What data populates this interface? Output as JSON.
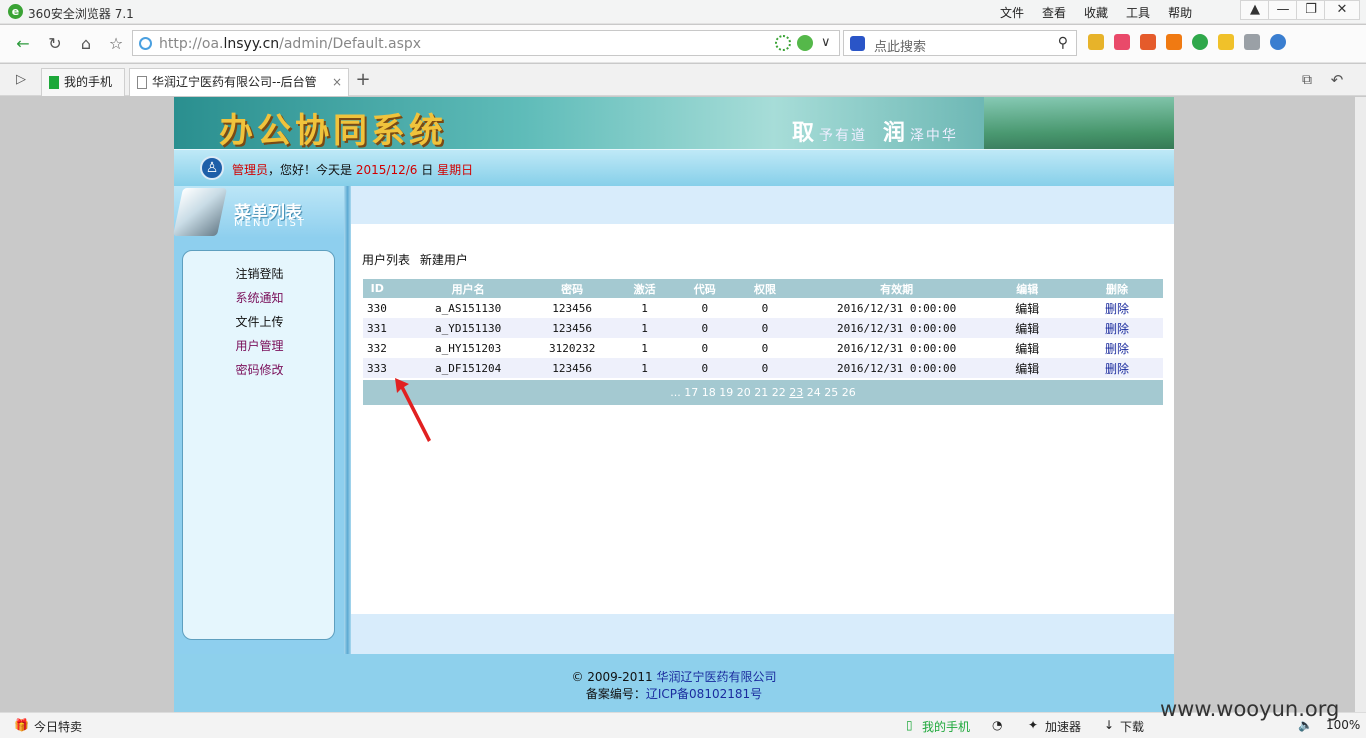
{
  "browser": {
    "title": "360安全浏览器 7.1",
    "menus": [
      "文件",
      "查看",
      "收藏",
      "工具",
      "帮助"
    ],
    "url_prefix": "http://oa.",
    "url_domain": "lnsyy.cn",
    "url_suffix": "/admin/Default.aspx",
    "search_placeholder": "点此搜索",
    "tabs": [
      {
        "label": "我的手机",
        "active": false
      },
      {
        "label": "华润辽宁医药有限公司--后台管",
        "active": true
      }
    ]
  },
  "header": {
    "system_name": "办公协同系统",
    "slogan_char1": "取",
    "slogan_part1": "予有道",
    "slogan_char2": "润",
    "slogan_part2": "泽中华"
  },
  "greeting": {
    "user": "管理员",
    "hello": "，您好！今天是",
    "date": "2015/12/6",
    "day_label": "日",
    "weekday": "星期日"
  },
  "sidebar": {
    "title": "菜单列表",
    "subtitle": "MENU LIST",
    "items": [
      {
        "label": "注销登陆",
        "style": "blue"
      },
      {
        "label": "系统通知",
        "style": "purple"
      },
      {
        "label": "文件上传",
        "style": "blue"
      },
      {
        "label": "用户管理",
        "style": "purple"
      },
      {
        "label": "密码修改",
        "style": "purple"
      }
    ]
  },
  "main": {
    "links": [
      "用户列表",
      "新建用户"
    ],
    "columns": [
      "ID",
      "用户名",
      "密码",
      "激活",
      "代码",
      "权限",
      "有效期",
      "编辑",
      "删除"
    ],
    "rows": [
      [
        "330",
        "a_AS151130",
        "123456",
        "1",
        "0",
        "0",
        "2016/12/31 0:00:00",
        "编辑",
        "删除"
      ],
      [
        "331",
        "a_YD151130",
        "123456",
        "1",
        "0",
        "0",
        "2016/12/31 0:00:00",
        "编辑",
        "删除"
      ],
      [
        "332",
        "a_HY151203",
        "3120232",
        "1",
        "0",
        "0",
        "2016/12/31 0:00:00",
        "编辑",
        "删除"
      ],
      [
        "333",
        "a_DF151204",
        "123456",
        "1",
        "0",
        "0",
        "2016/12/31 0:00:00",
        "编辑",
        "删除"
      ]
    ],
    "pager": {
      "prefix": "...",
      "pages": [
        "17",
        "18",
        "19",
        "20",
        "21",
        "22",
        "23",
        "24",
        "25",
        "26"
      ],
      "current": "23"
    }
  },
  "footer": {
    "copyright": "© 2009-2011",
    "company": "华润辽宁医药有限公司",
    "icp_label": "备案编号：",
    "icp": "辽ICP备08102181号"
  },
  "statusbar": {
    "left": "今日特卖",
    "phone": "我的手机",
    "accelerator": "加速器",
    "download": "下载",
    "zoom": "100%"
  },
  "watermark": "www.wooyun.org"
}
